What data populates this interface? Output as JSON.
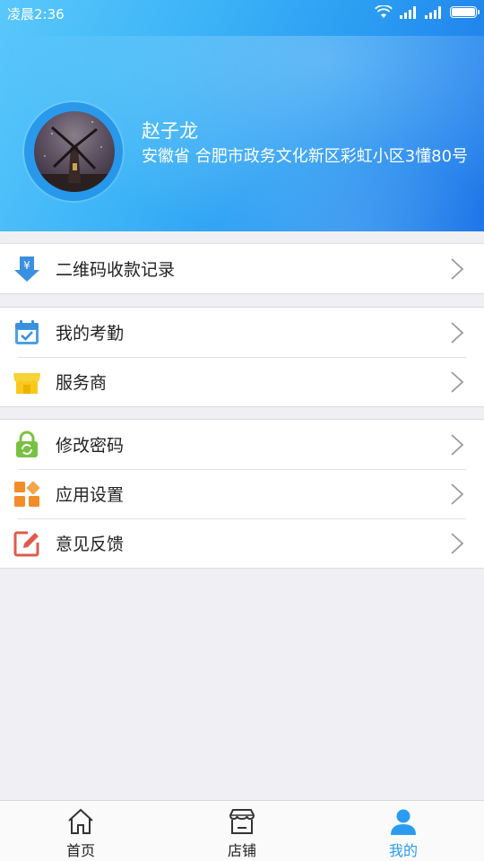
{
  "status_bar": {
    "time": "凌晨2:36"
  },
  "profile": {
    "name": "赵子龙",
    "address": "安徽省 合肥市政务文化新区彩虹小区3懂80号"
  },
  "menu_groups": [
    [
      {
        "label": "二维码收款记录",
        "icon": "qr-payment-download-icon"
      }
    ],
    [
      {
        "label": "我的考勤",
        "icon": "calendar-check-icon"
      },
      {
        "label": "服务商",
        "icon": "store-awning-icon"
      }
    ],
    [
      {
        "label": "修改密码",
        "icon": "lock-refresh-icon"
      },
      {
        "label": "应用设置",
        "icon": "app-grid-icon"
      },
      {
        "label": "意见反馈",
        "icon": "edit-feedback-icon"
      }
    ]
  ],
  "bottom_nav": [
    {
      "label": "首页",
      "icon": "home-icon"
    },
    {
      "label": "店铺",
      "icon": "shop-icon"
    },
    {
      "label": "我的",
      "icon": "user-icon"
    }
  ],
  "colors": {
    "accent": "#2a9bf2",
    "header_start": "#5ac8fb",
    "header_end": "#1a73e8"
  }
}
